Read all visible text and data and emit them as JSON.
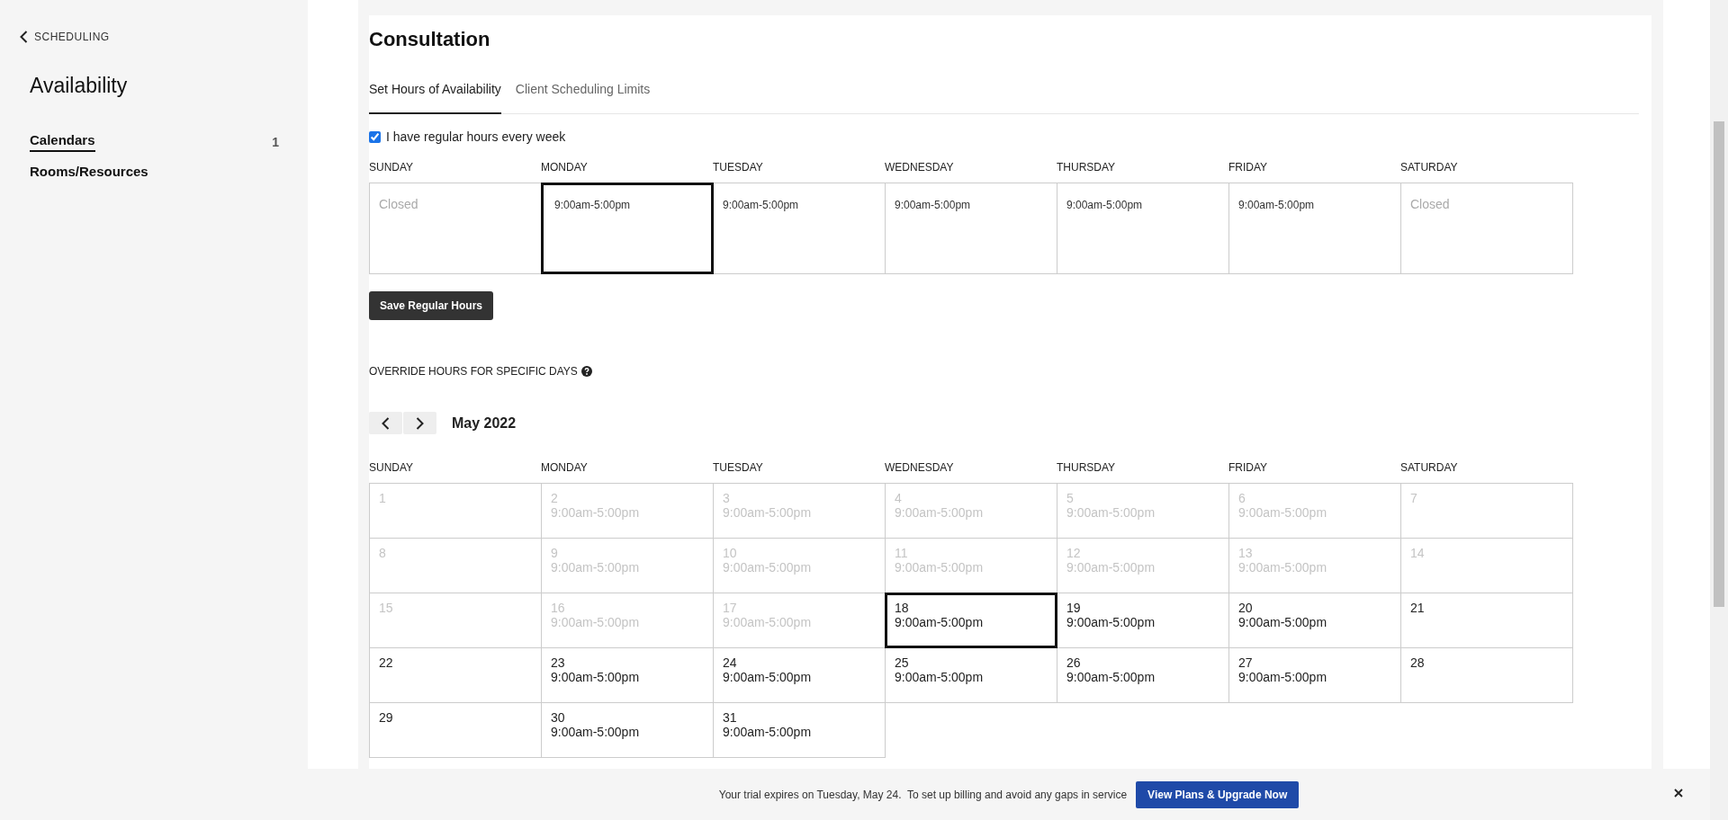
{
  "sidebar": {
    "back_link": "SCHEDULING",
    "title": "Availability",
    "items": [
      {
        "label": "Calendars",
        "count": "1",
        "selected": true
      },
      {
        "label": "Rooms/Resources",
        "selected": false
      }
    ]
  },
  "page": {
    "title": "Consultation",
    "tabs": [
      {
        "label": "Set Hours of Availability",
        "selected": true
      },
      {
        "label": "Client Scheduling Limits",
        "selected": false
      }
    ],
    "regular_hours": {
      "label": "I have regular hours every week",
      "checked": true
    },
    "week": [
      {
        "day": "SUNDAY",
        "hours": "Closed",
        "closed": true,
        "selected": false
      },
      {
        "day": "MONDAY",
        "hours": "9:00am-5:00pm",
        "closed": false,
        "selected": true
      },
      {
        "day": "TUESDAY",
        "hours": "9:00am-5:00pm",
        "closed": false,
        "selected": false
      },
      {
        "day": "WEDNESDAY",
        "hours": "9:00am-5:00pm",
        "closed": false,
        "selected": false
      },
      {
        "day": "THURSDAY",
        "hours": "9:00am-5:00pm",
        "closed": false,
        "selected": false
      },
      {
        "day": "FRIDAY",
        "hours": "9:00am-5:00pm",
        "closed": false,
        "selected": false
      },
      {
        "day": "SATURDAY",
        "hours": "Closed",
        "closed": true,
        "selected": false
      }
    ],
    "save_button": "Save Regular Hours",
    "override_label": "OVERRIDE HOURS FOR SPECIFIC DAYS",
    "month": "May 2022",
    "calendar_headers": [
      "SUNDAY",
      "MONDAY",
      "TUESDAY",
      "WEDNESDAY",
      "THURSDAY",
      "FRIDAY",
      "SATURDAY"
    ],
    "calendar_days": [
      {
        "date": "1",
        "past": true,
        "selected": false
      },
      {
        "date": "2",
        "hours": "9:00am-5:00pm",
        "past": true,
        "selected": false
      },
      {
        "date": "3",
        "hours": "9:00am-5:00pm",
        "past": true,
        "selected": false
      },
      {
        "date": "4",
        "hours": "9:00am-5:00pm",
        "past": true,
        "selected": false
      },
      {
        "date": "5",
        "hours": "9:00am-5:00pm",
        "past": true,
        "selected": false
      },
      {
        "date": "6",
        "hours": "9:00am-5:00pm",
        "past": true,
        "selected": false
      },
      {
        "date": "7",
        "past": true,
        "selected": false
      },
      {
        "date": "8",
        "past": true,
        "selected": false
      },
      {
        "date": "9",
        "hours": "9:00am-5:00pm",
        "past": true,
        "selected": false
      },
      {
        "date": "10",
        "hours": "9:00am-5:00pm",
        "past": true,
        "selected": false
      },
      {
        "date": "11",
        "hours": "9:00am-5:00pm",
        "past": true,
        "selected": false
      },
      {
        "date": "12",
        "hours": "9:00am-5:00pm",
        "past": true,
        "selected": false
      },
      {
        "date": "13",
        "hours": "9:00am-5:00pm",
        "past": true,
        "selected": false
      },
      {
        "date": "14",
        "past": true,
        "selected": false
      },
      {
        "date": "15",
        "past": true,
        "selected": false
      },
      {
        "date": "16",
        "hours": "9:00am-5:00pm",
        "past": true,
        "selected": false
      },
      {
        "date": "17",
        "hours": "9:00am-5:00pm",
        "past": true,
        "selected": false
      },
      {
        "date": "18",
        "hours": "9:00am-5:00pm",
        "past": false,
        "selected": true
      },
      {
        "date": "19",
        "hours": "9:00am-5:00pm",
        "past": false,
        "selected": false
      },
      {
        "date": "20",
        "hours": "9:00am-5:00pm",
        "past": false,
        "selected": false
      },
      {
        "date": "21",
        "past": false,
        "selected": false
      },
      {
        "date": "22",
        "past": false,
        "selected": false
      },
      {
        "date": "23",
        "hours": "9:00am-5:00pm",
        "past": false,
        "selected": false
      },
      {
        "date": "24",
        "hours": "9:00am-5:00pm",
        "past": false,
        "selected": false
      },
      {
        "date": "25",
        "hours": "9:00am-5:00pm",
        "past": false,
        "selected": false
      },
      {
        "date": "26",
        "hours": "9:00am-5:00pm",
        "past": false,
        "selected": false
      },
      {
        "date": "27",
        "hours": "9:00am-5:00pm",
        "past": false,
        "selected": false
      },
      {
        "date": "28",
        "past": false,
        "selected": false
      },
      {
        "date": "29",
        "past": false,
        "selected": false
      },
      {
        "date": "30",
        "hours": "9:00am-5:00pm",
        "past": false,
        "selected": false
      },
      {
        "date": "31",
        "hours": "9:00am-5:00pm",
        "past": false,
        "selected": false
      }
    ]
  },
  "banner": {
    "message": "Your trial expires on Tuesday, May 24.  To set up billing and avoid any gaps in service",
    "button": "View Plans & Upgrade Now"
  }
}
